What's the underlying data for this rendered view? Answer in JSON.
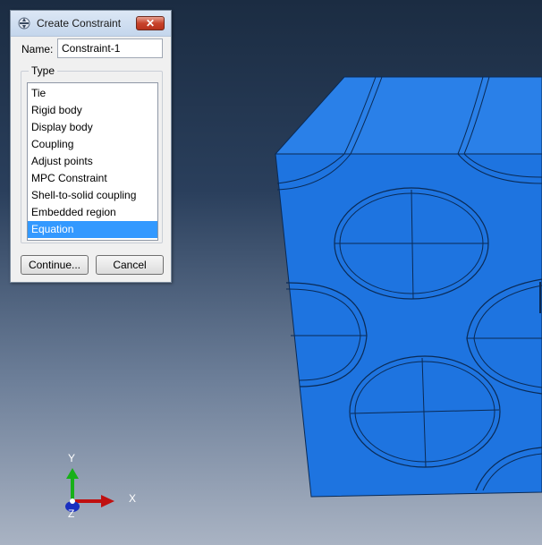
{
  "dialog": {
    "title": "Create Constraint",
    "close_symbol": "✕",
    "name_label": "Name:",
    "name_value": "Constraint-1",
    "type_legend": "Type",
    "type_items": [
      "Tie",
      "Rigid body",
      "Display body",
      "Coupling",
      "Adjust points",
      "MPC Constraint",
      "Shell-to-solid coupling",
      "Embedded region",
      "Equation"
    ],
    "selected_type": "Equation",
    "continue_label": "Continue...",
    "cancel_label": "Cancel"
  },
  "triad": {
    "x_label": "X",
    "y_label": "Y",
    "z_label": "Z"
  },
  "colors": {
    "model_blue": "#1e74e0",
    "selection_blue": "#3399ff"
  }
}
